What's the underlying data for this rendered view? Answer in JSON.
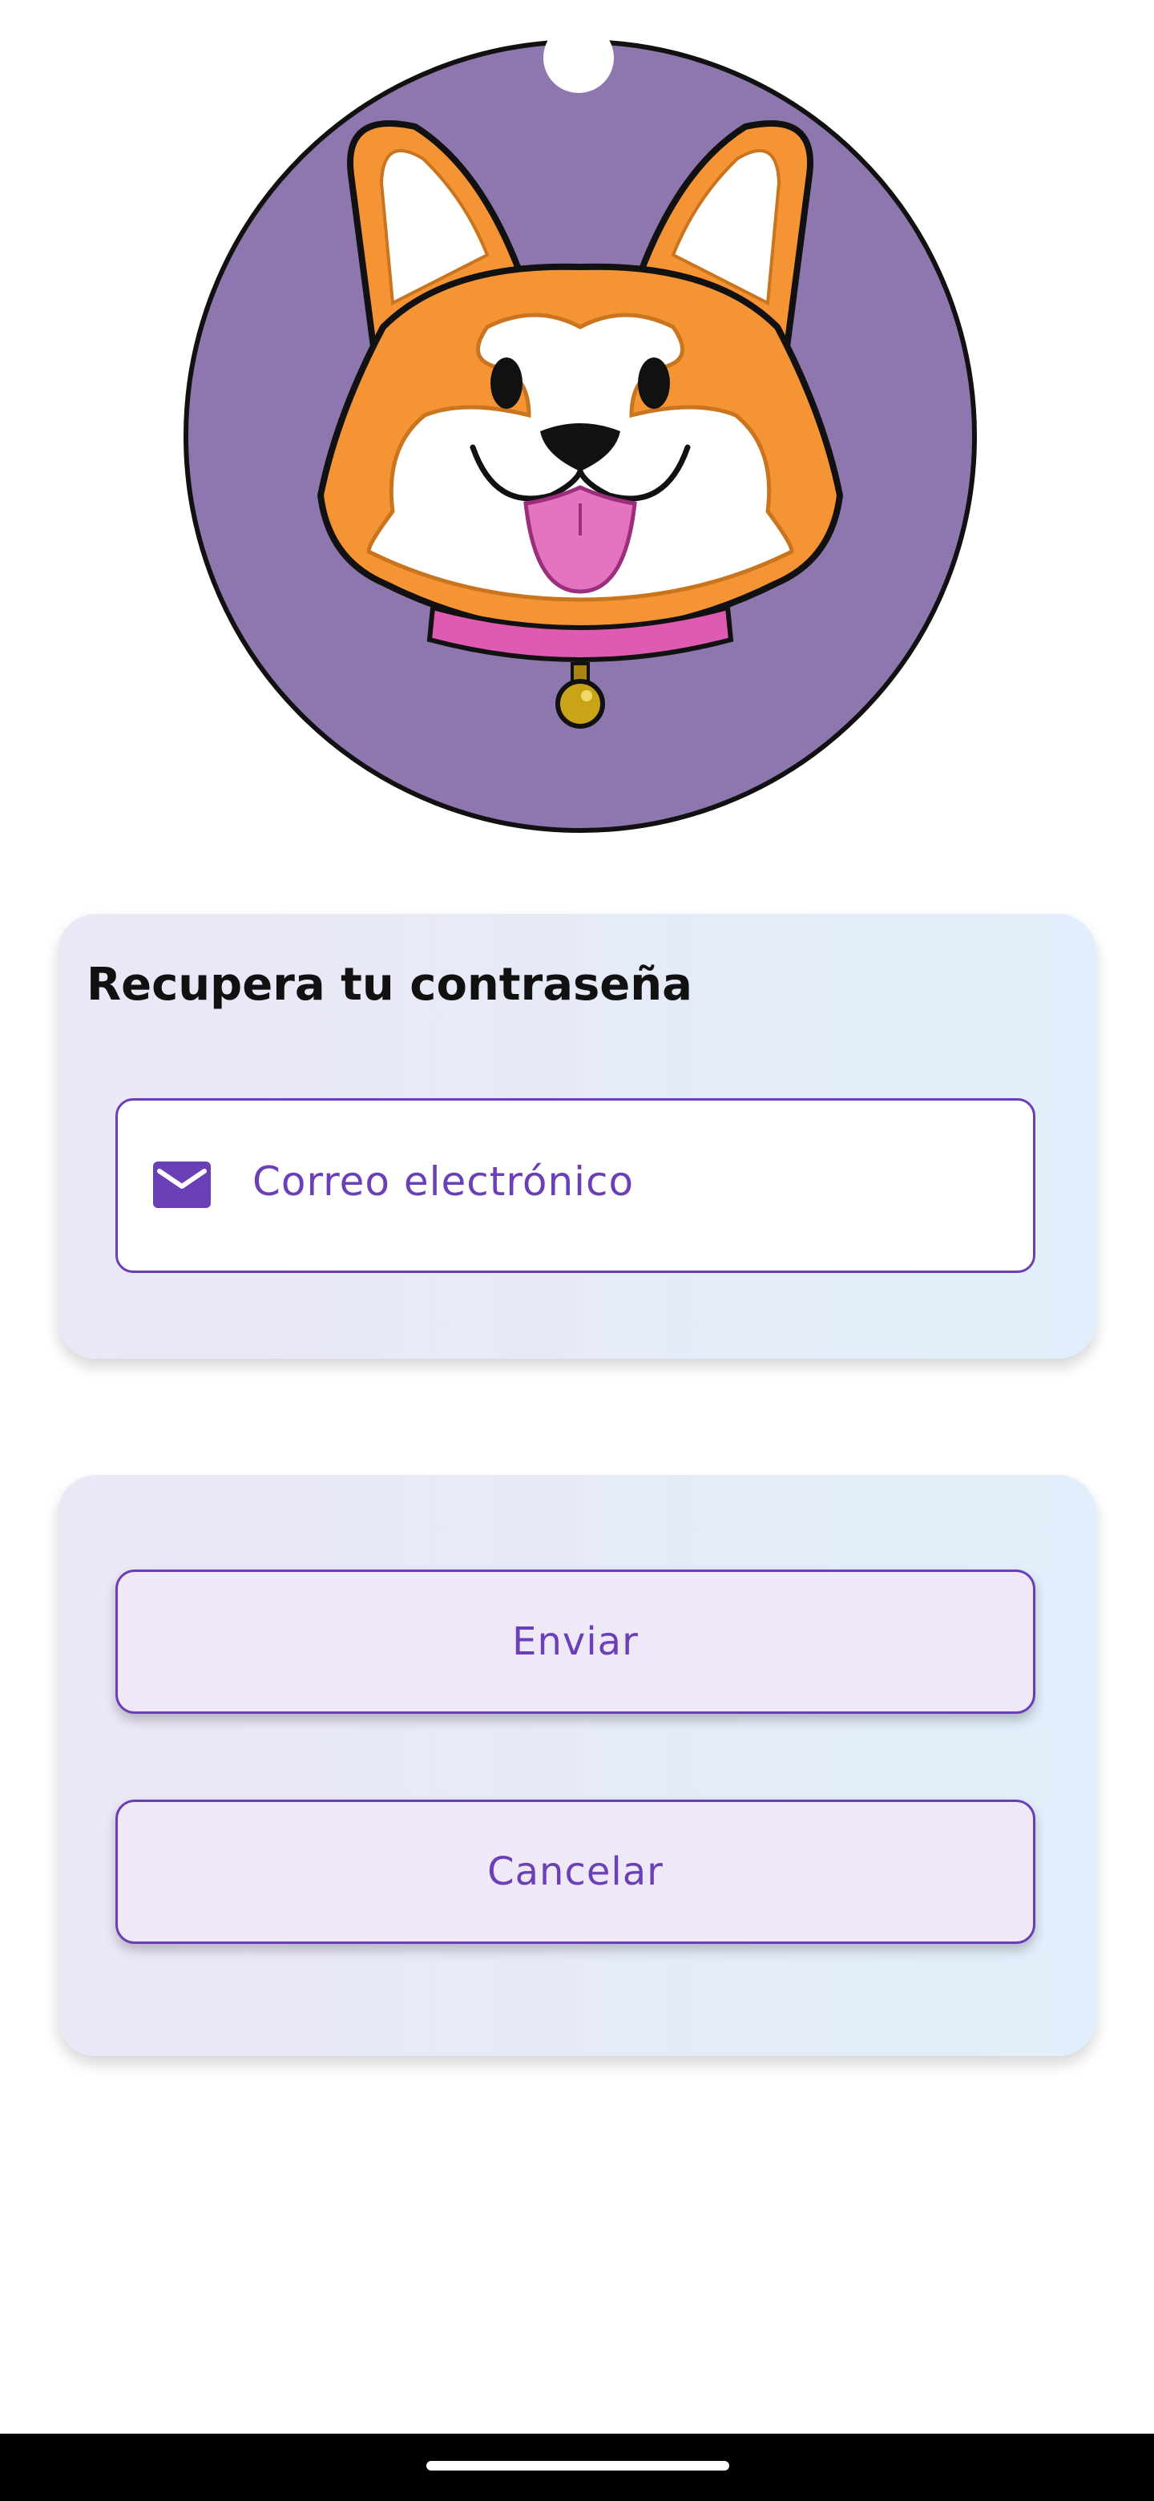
{
  "recover_card": {
    "title": "Recupera tu contraseña",
    "email_field": {
      "placeholder": "Correo electrónico",
      "icon": "mail-icon"
    }
  },
  "actions": {
    "send_label": "Enviar",
    "cancel_label": "Cancelar"
  },
  "colors": {
    "accent": "#6a3fb6",
    "logo_background": "#8e77ae",
    "button_fill": "#efe8f7"
  }
}
